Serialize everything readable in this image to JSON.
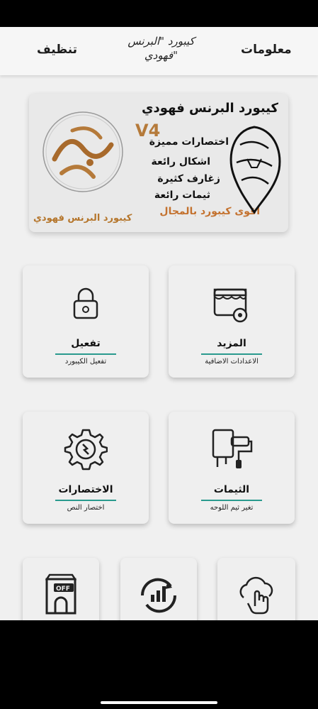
{
  "app_bar": {
    "title": "كيبورد \"البرنس فهودي\"",
    "info_label": "معلومات",
    "clean_label": "تنظيف"
  },
  "banner": {
    "heading": "كيبورد البرنس فهودي",
    "version": "V4",
    "features": [
      "اختصارات مميزة",
      "اشكال رائعة",
      "زغارف كثيرة",
      "ثيمات رائعة"
    ],
    "slogan": "اقوى كيبورد بالمجال",
    "signature": "كيبورد البرنس فهودي"
  },
  "cards": {
    "more": {
      "title": "المزيد",
      "subtitle": "الاعدادات الاضافية",
      "icon": "store-settings-icon"
    },
    "activate": {
      "title": "تفعيل",
      "subtitle": "تفعيل الكيبورد",
      "icon": "lock-icon"
    },
    "themes": {
      "title": "الثيمات",
      "subtitle": "تغير ثيم اللوحه",
      "icon": "paint-roller-icon"
    },
    "shortcuts": {
      "title": "الاختصارات",
      "subtitle": "اختصار النص",
      "icon": "gear-sync-icon"
    },
    "bottom_icons": [
      "touch-cloud-icon",
      "chart-refresh-icon",
      "shop-off-icon"
    ]
  },
  "colors": {
    "accent": "#2a9a8e",
    "brand_gold": "#c4722f",
    "background": "#f0f0f0"
  }
}
